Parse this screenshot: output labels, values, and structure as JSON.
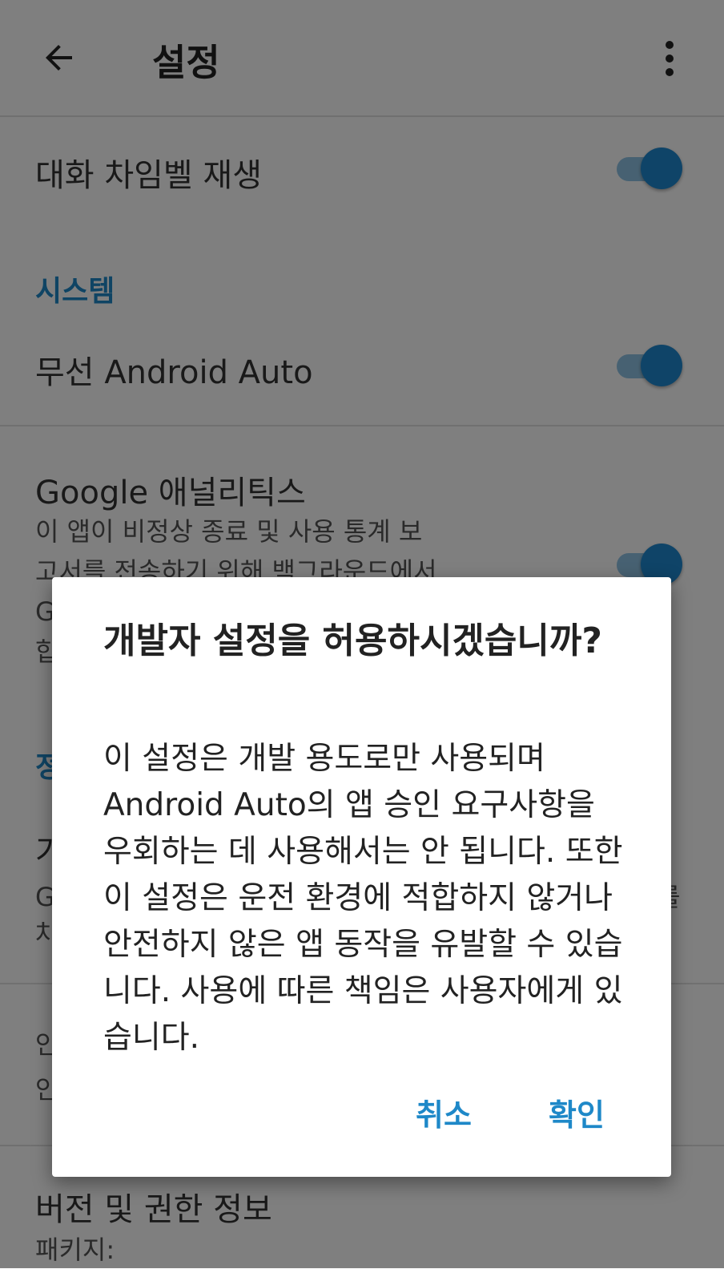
{
  "appbar": {
    "title": "설정",
    "back_icon": "arrow-left-icon",
    "more_icon": "more-vert-icon"
  },
  "settings": {
    "chime": {
      "title": "대화 차임벨 재생",
      "enabled": true
    },
    "system_header": "시스템",
    "wireless": {
      "title": "무선 Android Auto",
      "enabled": true
    },
    "analytics": {
      "title": "Google 애널리틱스",
      "summary_line1": "이 앱이 비정상 종료 및 사용 통계 보",
      "summary_line2": "고서를 전송하기 위해 백그라운드에서",
      "summary_line3": "G",
      "summary_line4": "합",
      "enabled": true
    },
    "partial": {
      "header_frag": "정",
      "line_a": "가",
      "line_b": "G",
      "line_b_end": "를",
      "line_c": "차",
      "line_d": "안",
      "line_e": "안"
    },
    "version": {
      "title": "버전 및 권한 정보",
      "summary": "패키지:"
    }
  },
  "dialog": {
    "title": "개발자 설정을 허용하시겠습니까?",
    "message": "이 설정은 개발 용도로만 사용되며 Android Auto의 앱 승인 요구사항을 우회하는 데 사용해서는 안 됩니다. 또한 이 설정은 운전 환경에 적합하지 않거나 안전하지 않은 앱 동작을 유발할 수 있습니다. 사용에 따른 책임은 사용자에게 있습니다.",
    "cancel_label": "취소",
    "ok_label": "확인"
  },
  "colors": {
    "accent": "#1e88c8",
    "switch_thumb": "#1e88d0",
    "switch_track": "#8fc3e4"
  }
}
